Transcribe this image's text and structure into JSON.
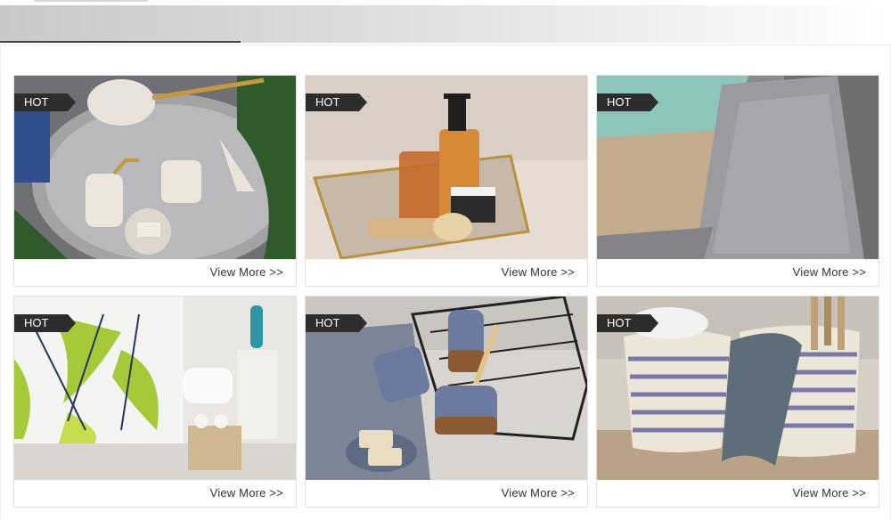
{
  "badge_label": "HOT",
  "view_more_label": "View More >>",
  "products": [
    {
      "image": "bathroom-accessory-set-photo"
    },
    {
      "image": "soap-dispenser-tray-photo"
    },
    {
      "image": "chenille-bath-mat-photo"
    },
    {
      "image": "tropical-shower-curtain-photo"
    },
    {
      "image": "ceramic-toothbrush-holder-photo"
    },
    {
      "image": "cotton-rope-basket-photo"
    }
  ]
}
